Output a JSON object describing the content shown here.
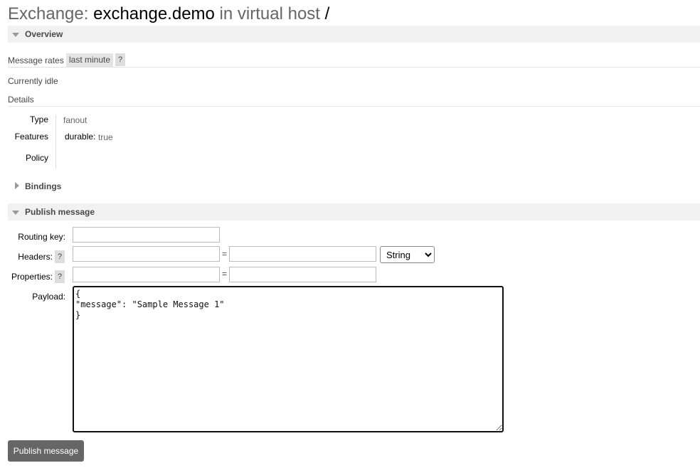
{
  "title": {
    "prefix": "Exchange: ",
    "name": "exchange.demo",
    "middle": " in virtual host ",
    "vhost": "/"
  },
  "overview": {
    "header": "Overview",
    "message_rates_label": "Message rates",
    "rate_period": "last minute",
    "help": "?",
    "status": "Currently idle",
    "details_label": "Details",
    "details": {
      "type_label": "Type",
      "type_value": "fanout",
      "features_label": "Features",
      "feature_key": "durable:",
      "feature_value": "true",
      "policy_label": "Policy",
      "policy_value": ""
    }
  },
  "bindings": {
    "header": "Bindings"
  },
  "publish": {
    "header": "Publish message",
    "routing_key_label": "Routing key:",
    "routing_key_value": "",
    "headers_label": "Headers:",
    "headers_help": "?",
    "header_key_value": "",
    "header_val_value": "",
    "equals": "=",
    "header_type": "String",
    "header_type_options": [
      "String"
    ],
    "properties_label": "Properties:",
    "properties_help": "?",
    "property_key_value": "",
    "property_val_value": "",
    "payload_label": "Payload:",
    "payload_value": "{\n\"message\": \"Sample Message 1\"\n}",
    "submit_label": "Publish message"
  },
  "colors": {
    "section_bg": "#f1f1f1",
    "button_bg": "#666666",
    "pill_bg": "#e4e4e4"
  }
}
